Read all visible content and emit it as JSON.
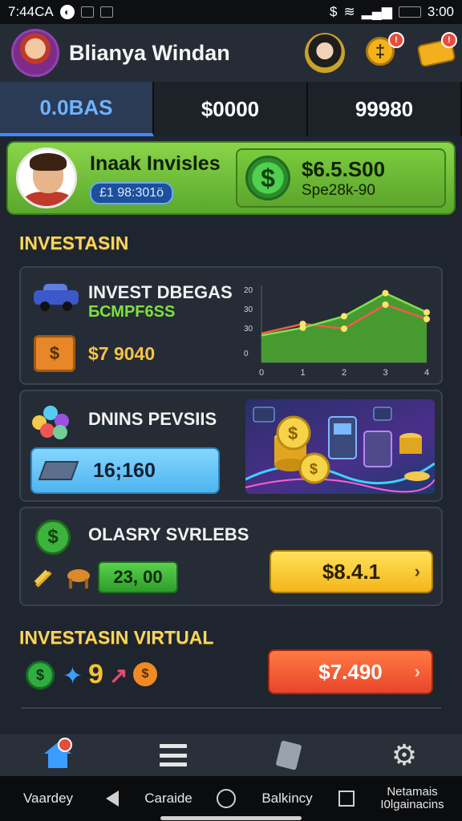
{
  "status_bar": {
    "time": "7:44CA",
    "battery": "3:00"
  },
  "header": {
    "user_name": "Blianya Windan",
    "coins_badge": "!",
    "cash_badge": "!"
  },
  "tabs": [
    {
      "label": "0.0BAS",
      "active": true
    },
    {
      "label": "$0000",
      "active": false
    },
    {
      "label": "99980",
      "active": false
    }
  ],
  "profile": {
    "name": "Inaak Invisles",
    "id_badge": "£1 98:301ö",
    "balance": "$6.5.S00",
    "balance_sub": "Spe28k-90"
  },
  "section_investasin": "INVESTASIN",
  "panel_invest": {
    "title": "INVEST DBEGAS",
    "subtitle": "БСМPF6SS",
    "amount": "$7 9040"
  },
  "chart_data": {
    "type": "line",
    "x": [
      0,
      1,
      2,
      3,
      4
    ],
    "y_tick_labels": [
      "20",
      "30",
      "30",
      "0"
    ],
    "x_tick_labels": [
      "0",
      "1",
      "2",
      "3",
      "4"
    ],
    "series": [
      {
        "values": [
          30,
          40,
          35,
          60,
          45
        ]
      },
      {
        "values": [
          28,
          36,
          48,
          72,
          52
        ]
      }
    ],
    "colors": [
      "#f25a4e",
      "#7fe14a"
    ]
  },
  "panel_dnins": {
    "title": "DNINS PEVSIIS",
    "value": "16;160"
  },
  "panel_olasry": {
    "title": "OLASRY SVRLEBS",
    "chip_value": "23, 00",
    "button_label": "$8.4.1"
  },
  "section_virtual": "INVESTASIN VIRTUAL",
  "virtual": {
    "nine_glyph": "9",
    "button_label": "$7.490"
  },
  "bottom_nav": [
    {
      "icon": "home-icon",
      "has_badge": true
    },
    {
      "icon": "list-icon"
    },
    {
      "icon": "card-icon"
    },
    {
      "icon": "gear-icon"
    }
  ],
  "system_bar": {
    "label_1": "Vaardey",
    "label_2": "Caraide",
    "label_3": "Balkincy",
    "label_4a": "Netamais",
    "label_4b": "I0lgainacins"
  },
  "colors": {
    "accent_blue": "#3b9cff",
    "accent_gold": "#f7d560",
    "accent_green": "#7fe14a"
  }
}
